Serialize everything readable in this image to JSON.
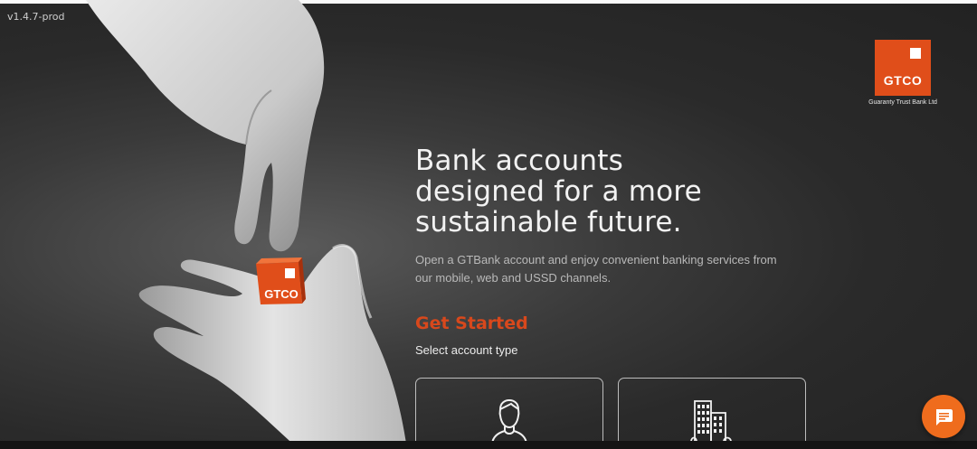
{
  "version": "v1.4.7-prod",
  "brand": {
    "logo_text": "GTCO",
    "tagline": "Guaranty Trust Bank Ltd",
    "cube_text": "GTCO",
    "accent": "#e04e1a"
  },
  "hero": {
    "headline_line1": "Bank accounts",
    "headline_line2": "designed for a more",
    "headline_line3": "sustainable future.",
    "subtext_line1": "Open a GTBank account and enjoy convenient banking services from",
    "subtext_line2": "our mobile, web and USSD channels."
  },
  "account_select": {
    "title": "Get Started",
    "subtitle": "Select account type",
    "options": [
      {
        "icon": "person-icon"
      },
      {
        "icon": "office-building-icon"
      }
    ]
  },
  "chat": {
    "icon": "chat-icon",
    "color": "#ef6c1d"
  }
}
